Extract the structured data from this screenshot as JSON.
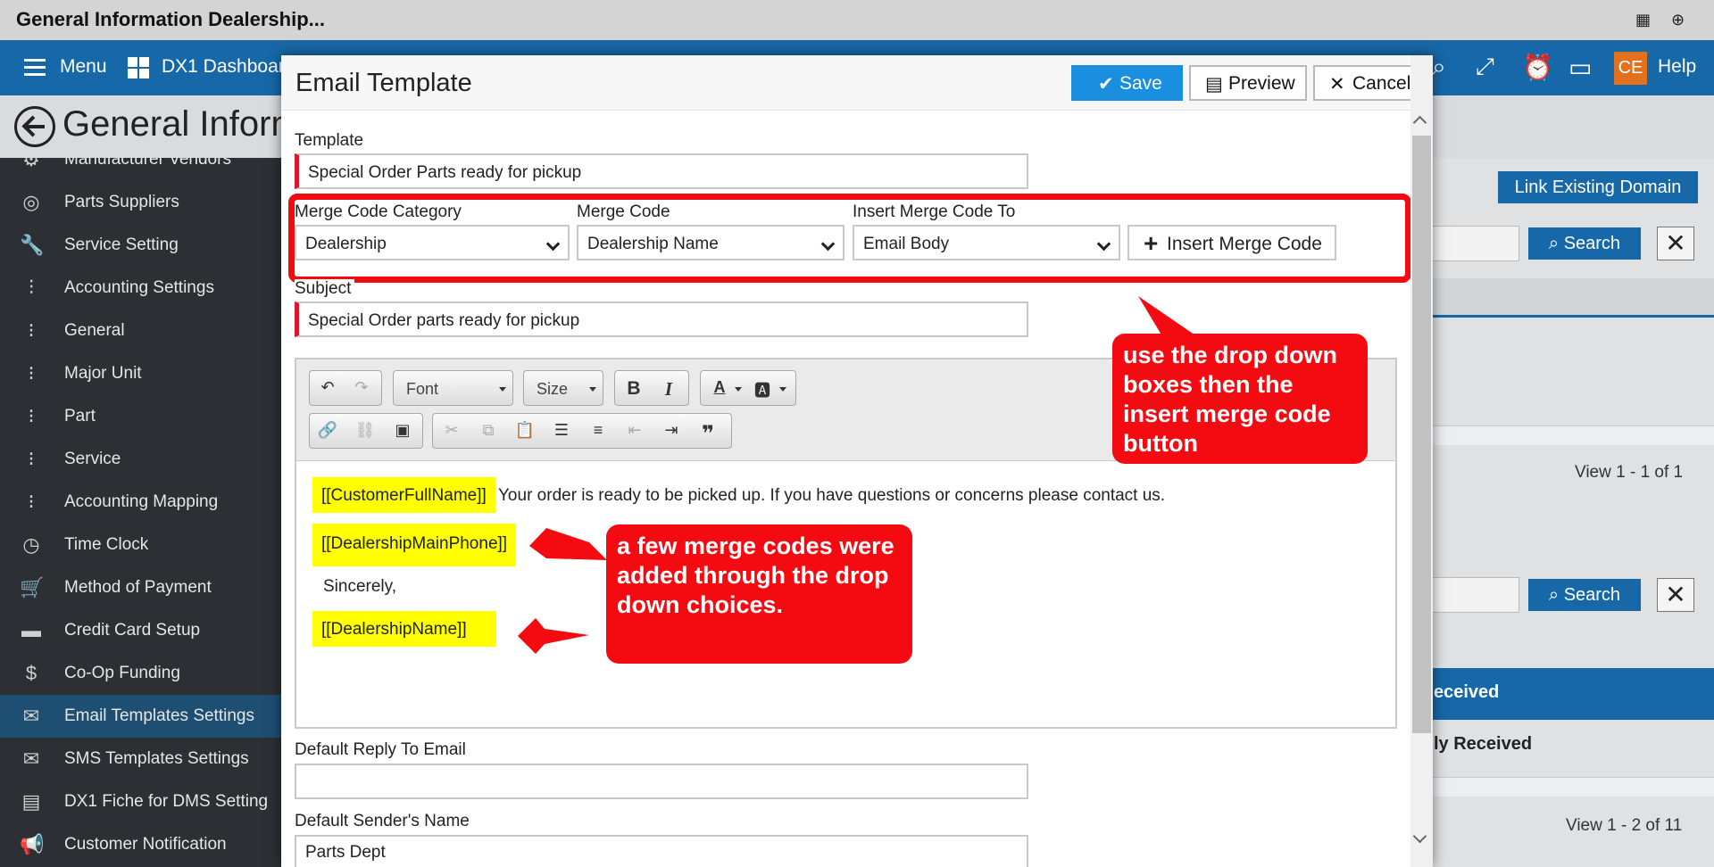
{
  "window": {
    "title": "General Information Dealership..."
  },
  "appbar": {
    "menu_label": "Menu",
    "dashboard_label": "DX1 Dashboar",
    "avatar_initials": "CE",
    "help_label": "Help"
  },
  "page": {
    "title": "General Inform"
  },
  "sidebar": {
    "items": [
      {
        "label": "Manufacturer Vendors",
        "icon": "gear-icon"
      },
      {
        "label": "Parts Suppliers",
        "icon": "lifebuoy-icon"
      },
      {
        "label": "Service Setting",
        "icon": "wrench-icon"
      },
      {
        "label": "Accounting Settings",
        "icon": "sliders-icon"
      },
      {
        "label": "General",
        "icon": "dots-icon"
      },
      {
        "label": "Major Unit",
        "icon": "dots-icon"
      },
      {
        "label": "Part",
        "icon": "dots-icon"
      },
      {
        "label": "Service",
        "icon": "dots-icon"
      },
      {
        "label": "Accounting Mapping",
        "icon": "dots-icon"
      },
      {
        "label": "Time Clock",
        "icon": "clock-icon"
      },
      {
        "label": "Method of Payment",
        "icon": "cart-icon"
      },
      {
        "label": "Credit Card Setup",
        "icon": "credit-card-icon"
      },
      {
        "label": "Co-Op Funding",
        "icon": "dollar-icon"
      },
      {
        "label": "Email Templates Settings",
        "icon": "envelope-open-icon"
      },
      {
        "label": "SMS Templates Settings",
        "icon": "envelope-icon"
      },
      {
        "label": "DX1 Fiche for DMS Setting",
        "icon": "list-icon"
      },
      {
        "label": "Customer Notification",
        "icon": "megaphone-icon"
      }
    ],
    "active_index": 13
  },
  "background": {
    "link_domain_label": "Link Existing Domain",
    "search_label_1": "Search",
    "search_label_2": "Search",
    "view_count_1": "View 1 - 1 of 1",
    "view_count_2": "View 1 - 2 of 11",
    "received_label": "eceived",
    "received_label_2": "ly Received"
  },
  "dialog": {
    "title": "Email Template",
    "save_label": "Save",
    "preview_label": "Preview",
    "cancel_label": "Cancel",
    "template_label": "Template",
    "template_value": "Special Order Parts ready for pickup",
    "merge_category_label": "Merge Code Category",
    "merge_category_value": "Dealership",
    "merge_code_label": "Merge Code",
    "merge_code_value": "Dealership Name",
    "insert_to_label": "Insert Merge Code To",
    "insert_to_value": "Email Body",
    "insert_button_label": "Insert Merge Code",
    "subject_label": "Subject",
    "subject_value": "Special Order parts ready for pickup",
    "toolbar": {
      "font_label": "Font",
      "size_label": "Size"
    },
    "body": {
      "code_1": "[[CustomerFullName]]",
      "line_1_text": "Your order is ready to be picked up.  If you have questions or concerns please contact us.",
      "code_2": "[[DealershipMainPhone]]",
      "line_3_text": "Sincerely,",
      "code_3": "[[DealershipName]]"
    },
    "reply_to_label": "Default Reply To Email",
    "reply_to_value": "",
    "sender_name_label": "Default Sender's Name",
    "sender_name_value": "Parts Dept"
  },
  "callouts": {
    "top_text": "use the drop down boxes then the insert merge code button",
    "bottom_text": "a few  merge codes were added through the drop down choices."
  },
  "colors": {
    "accent_blue": "#1768a9",
    "save_blue": "#1a8fe0",
    "callout_red": "#f40b12",
    "highlight_yellow": "#ffff00",
    "sidebar_bg": "#2c3034",
    "required_red": "#d9182e"
  }
}
